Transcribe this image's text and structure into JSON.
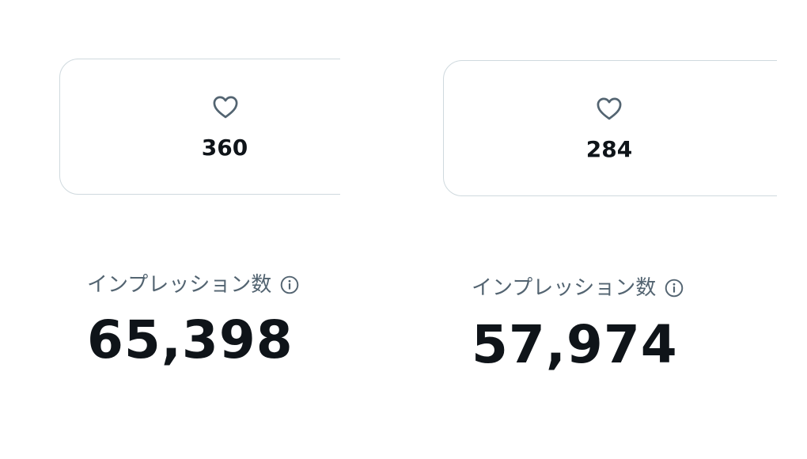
{
  "cards": [
    {
      "likes": {
        "icon": "heart-outline-icon",
        "count": "360"
      },
      "impressions": {
        "label": "インプレッション数",
        "info_icon": "info-circle-icon",
        "value": "65,398"
      }
    },
    {
      "likes": {
        "icon": "heart-outline-icon",
        "count": "284"
      },
      "impressions": {
        "label": "インプレッション数",
        "info_icon": "info-circle-icon",
        "value": "57,974"
      }
    }
  ],
  "colors": {
    "text_primary": "#0f1419",
    "text_secondary": "#536471",
    "border": "#cfd9de"
  }
}
